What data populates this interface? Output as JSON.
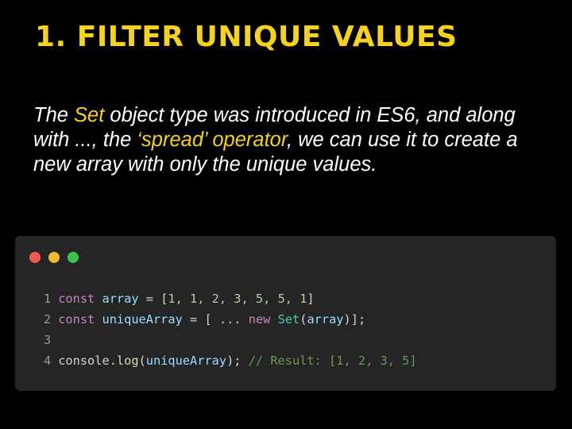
{
  "title": "1. FILTER UNIQUE VALUES",
  "description": {
    "part1": "The ",
    "highlight1": "Set",
    "part2": " object type was introduced in ES6, and along with ..., the ",
    "highlight2": "‘spread’ operator",
    "part3": ", we can use it to create a new array with only the unique values."
  },
  "colors": {
    "accent": "#f5d21f",
    "background": "#000000",
    "code_background": "#252526"
  },
  "window_controls": [
    "close",
    "minimize",
    "maximize"
  ],
  "code": {
    "line1": {
      "num": "1",
      "kw": "const",
      "var": "array",
      "op": " = ",
      "open": "[",
      "values": "1, 1, 2, 3, 5, 5, 1",
      "close": "]"
    },
    "line2": {
      "num": "2",
      "kw": "const",
      "var": "uniqueArray",
      "op": " = ",
      "open": "[",
      "spread": "...",
      "kw_new": "new",
      "cls": "Set",
      "paren_open": "(",
      "arg": "array",
      "end": ")];"
    },
    "line3": {
      "num": "3"
    },
    "line4": {
      "num": "4",
      "obj": "console",
      "dot": ".",
      "fn": "log",
      "paren_open": "(",
      "arg": "uniqueArray",
      "end": ");",
      "comment": "// Result: [1, 2, 3, 5]"
    }
  }
}
